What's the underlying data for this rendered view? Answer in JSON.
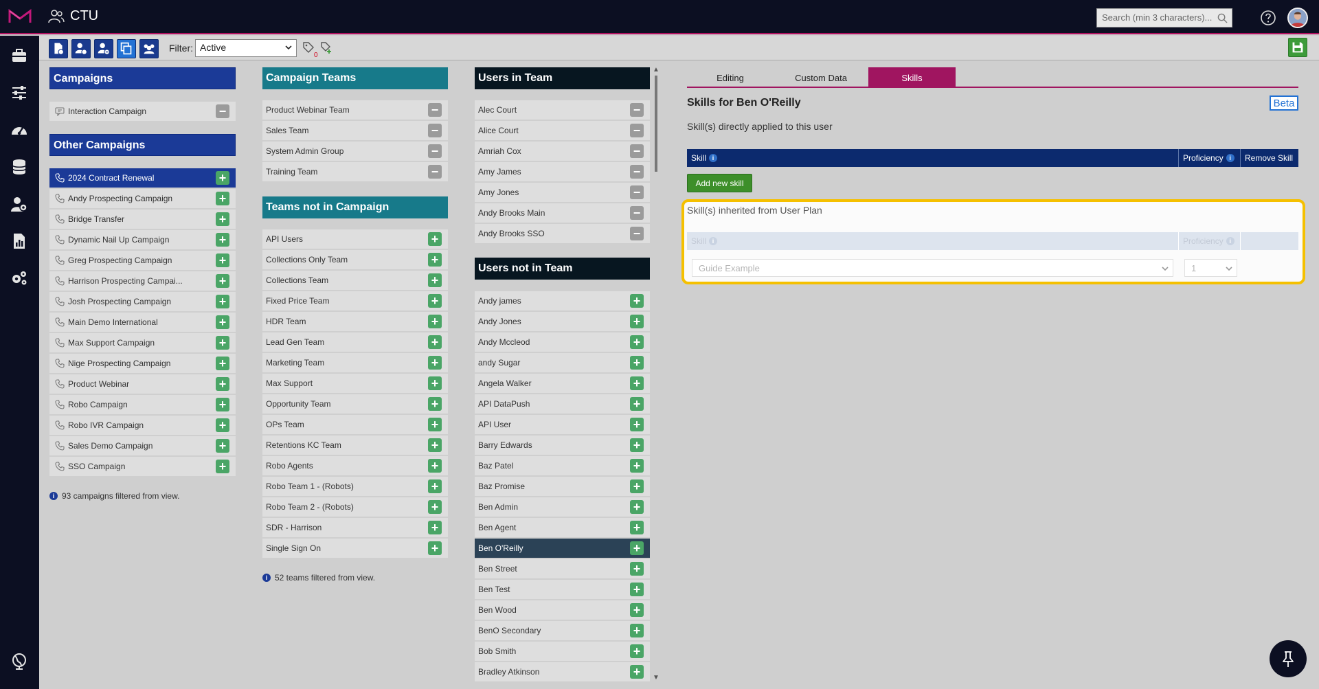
{
  "app": {
    "title": "CTU"
  },
  "search": {
    "placeholder": "Search (min 3 characters)..."
  },
  "toolbar": {
    "filter_label": "Filter:",
    "filter_value": "Active",
    "tag_count": "0"
  },
  "campaigns": {
    "header": "Campaigns",
    "items": [
      {
        "label": "Interaction Campaign"
      }
    ]
  },
  "other_campaigns": {
    "header": "Other Campaigns",
    "items": [
      {
        "label": "2024 Contract Renewal"
      },
      {
        "label": "Andy Prospecting Campaign"
      },
      {
        "label": "Bridge Transfer"
      },
      {
        "label": "Dynamic Nail Up Campaign"
      },
      {
        "label": "Greg Prospecting Campaign"
      },
      {
        "label": "Harrison Prospecting Campai..."
      },
      {
        "label": "Josh Prospecting Campaign"
      },
      {
        "label": "Main Demo International"
      },
      {
        "label": "Max Support Campaign"
      },
      {
        "label": "Nige Prospecting Campaign"
      },
      {
        "label": "Product Webinar"
      },
      {
        "label": "Robo Campaign"
      },
      {
        "label": "Robo IVR Campaign"
      },
      {
        "label": "Sales Demo Campaign"
      },
      {
        "label": "SSO Campaign"
      }
    ],
    "footnote": "93 campaigns filtered from view."
  },
  "campaign_teams": {
    "header": "Campaign Teams",
    "items": [
      {
        "label": "Product Webinar Team"
      },
      {
        "label": "Sales Team"
      },
      {
        "label": "System Admin Group"
      },
      {
        "label": "Training Team"
      }
    ]
  },
  "teams_not_in_campaign": {
    "header": "Teams not in Campaign",
    "items": [
      {
        "label": "API Users"
      },
      {
        "label": "Collections Only Team"
      },
      {
        "label": "Collections Team"
      },
      {
        "label": "Fixed Price Team"
      },
      {
        "label": "HDR Team"
      },
      {
        "label": "Lead Gen Team"
      },
      {
        "label": "Marketing Team"
      },
      {
        "label": "Max Support"
      },
      {
        "label": "Opportunity Team"
      },
      {
        "label": "OPs Team"
      },
      {
        "label": "Retentions KC Team"
      },
      {
        "label": "Robo Agents"
      },
      {
        "label": "Robo Team 1 - (Robots)"
      },
      {
        "label": "Robo Team 2 - (Robots)"
      },
      {
        "label": "SDR - Harrison"
      },
      {
        "label": "Single Sign On"
      }
    ],
    "footnote": "52 teams filtered from view."
  },
  "users_in_team": {
    "header": "Users in Team",
    "items": [
      {
        "label": "Alec Court"
      },
      {
        "label": "Alice Court"
      },
      {
        "label": "Amriah Cox"
      },
      {
        "label": "Amy James"
      },
      {
        "label": "Amy Jones"
      },
      {
        "label": "Andy Brooks Main"
      },
      {
        "label": "Andy Brooks SSO"
      }
    ]
  },
  "users_not_in_team": {
    "header": "Users not in Team",
    "items": [
      {
        "label": "Andy james"
      },
      {
        "label": "Andy Jones"
      },
      {
        "label": "Andy Mccleod"
      },
      {
        "label": "andy Sugar"
      },
      {
        "label": "Angela Walker"
      },
      {
        "label": "API DataPush"
      },
      {
        "label": "API User"
      },
      {
        "label": "Barry Edwards"
      },
      {
        "label": "Baz Patel"
      },
      {
        "label": "Baz Promise"
      },
      {
        "label": "Ben Admin"
      },
      {
        "label": "Ben Agent"
      },
      {
        "label": "Ben O'Reilly"
      },
      {
        "label": "Ben Street"
      },
      {
        "label": "Ben Test"
      },
      {
        "label": "Ben Wood"
      },
      {
        "label": "BenO Secondary"
      },
      {
        "label": "Bob Smith"
      },
      {
        "label": "Bradley Atkinson"
      }
    ]
  },
  "tabs": [
    {
      "label": "Editing"
    },
    {
      "label": "Custom Data"
    },
    {
      "label": "Skills"
    }
  ],
  "skills": {
    "title": "Skills for Ben O'Reilly",
    "beta": "Beta",
    "direct_text": "Skill(s) directly applied to this user",
    "col_skill": "Skill",
    "col_proficiency": "Proficiency",
    "col_remove": "Remove Skill",
    "add_button": "Add new skill",
    "inherited_text": "Skill(s) inherited from User Plan",
    "inherited_skill_value": "Guide Example",
    "inherited_proficiency_value": "1"
  },
  "colors": {
    "accent": "#a01560",
    "panel_blue": "#1b3a97",
    "panel_teal": "#177a8a",
    "highlight": "#f5c000"
  }
}
